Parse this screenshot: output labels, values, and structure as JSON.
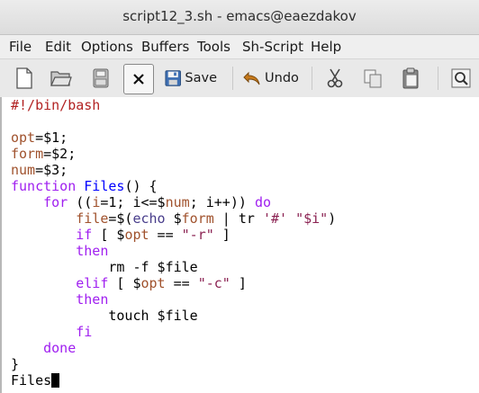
{
  "window": {
    "title": "script12_3.sh - emacs@eaezdakov"
  },
  "menu": [
    "File",
    "Edit",
    "Options",
    "Buffers",
    "Tools",
    "Sh-Script",
    "Help"
  ],
  "toolbar": {
    "save_label": "Save",
    "undo_label": "Undo"
  },
  "icons": [
    "new-file-icon",
    "open-folder-icon",
    "disk-icon",
    "close-icon",
    "save-icon",
    "undo-icon",
    "cut-icon",
    "copy-icon",
    "paste-icon",
    "search-icon"
  ],
  "code": {
    "l1": "#!/bin/bash",
    "l3a": "opt",
    "l3b": "=$1;",
    "l4a": "form",
    "l4b": "=$2;",
    "l5a": "num",
    "l5b": "=$3;",
    "l6a": "function",
    "l6b": " ",
    "l6c": "Files",
    "l6d": "() {",
    "l7a": "    ",
    "l7b": "for",
    "l7c": " ((",
    "l7d": "i",
    "l7e": "=1; i<=$",
    "l7f": "num",
    "l7g": "; i++)) ",
    "l7h": "do",
    "l8a": "        ",
    "l8b": "file",
    "l8c": "=$(",
    "l8d": "echo",
    "l8e": " $",
    "l8f": "form",
    "l8g": " | tr ",
    "l8h": "'#'",
    "l8i": " ",
    "l8j": "\"$i\"",
    "l8k": ")",
    "l9a": "        ",
    "l9b": "if",
    "l9c": " [ $",
    "l9d": "opt",
    "l9e": " == ",
    "l9f": "\"-r\"",
    "l9g": " ]",
    "l10a": "        ",
    "l10b": "then",
    "l11": "            rm -f $file",
    "l12a": "        ",
    "l12b": "elif",
    "l12c": " [ $",
    "l12d": "opt",
    "l12e": " == ",
    "l12f": "\"-c\"",
    "l12g": " ]",
    "l13a": "        ",
    "l13b": "then",
    "l14": "            touch $file",
    "l15a": "        ",
    "l15b": "fi",
    "l16a": "    ",
    "l16b": "done",
    "l17": "}",
    "l18": "Files"
  },
  "colors": {
    "comment": "#b22222",
    "variable": "#a0522d",
    "keyword": "#a020f0",
    "builtin": "#483d8b",
    "function": "#0000ff",
    "string": "#8b2252"
  }
}
